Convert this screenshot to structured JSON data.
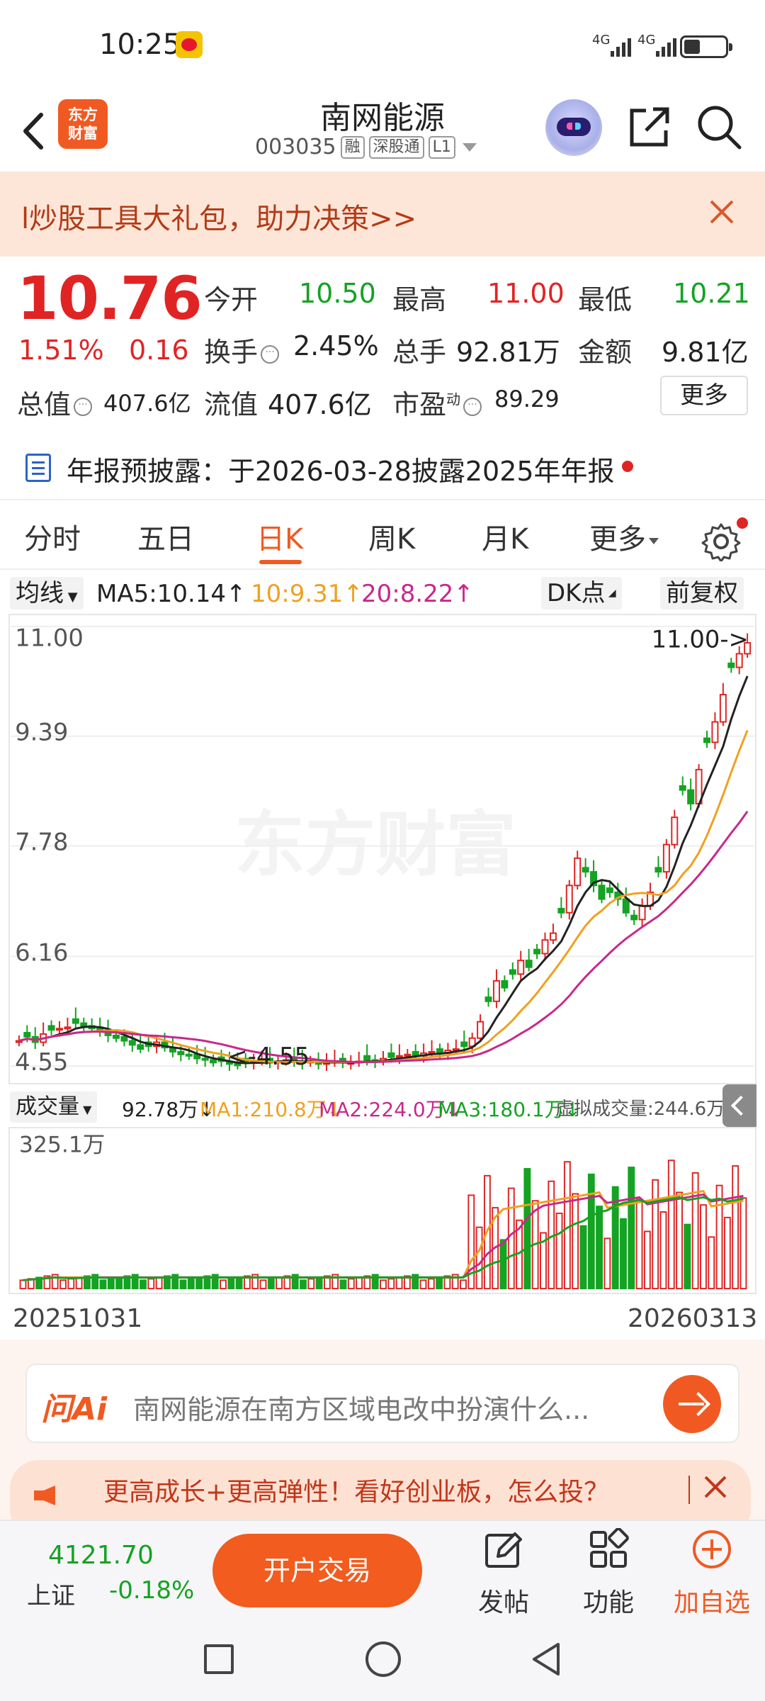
{
  "status_bar": {
    "time": "10:25",
    "signal1": "4G",
    "signal2": "4G",
    "battery_level": 0.3
  },
  "header": {
    "logo_text_line1": "东方",
    "logo_text_line2": "财富",
    "title": "南网能源",
    "code": "003035",
    "tags": [
      "融",
      "深股通",
      "L1"
    ]
  },
  "promo": {
    "text": "l炒股工具大礼包，助力决策>>"
  },
  "quote": {
    "price": "10.76",
    "change_pct": "1.51%",
    "change_amt": "0.16",
    "fields": {
      "open_label": "今开",
      "open_value": "10.50",
      "high_label": "最高",
      "high_value": "11.00",
      "low_label": "最低",
      "low_value": "10.21",
      "turnover_label": "换手",
      "turnover_value": "2.45%",
      "volume_label": "总手",
      "volume_value": "92.81万",
      "amount_label": "金额",
      "amount_value": "9.81亿",
      "mktcap_label": "总值",
      "mktcap_value": "407.6亿",
      "float_label": "流值",
      "float_value": "407.6亿",
      "pe_label": "市盈",
      "pe_superscript": "动",
      "pe_value": "89.29"
    },
    "more_button": "更多"
  },
  "notice": {
    "text": "年报预披露：于2026-03-28披露2025年年报"
  },
  "tabs": {
    "items": [
      "分时",
      "五日",
      "日K",
      "周K",
      "月K",
      "更多"
    ],
    "active": "日K"
  },
  "ma_bar": {
    "selector": "均线",
    "ma5": "MA5:10.14↑",
    "ma10": "10:9.31↑",
    "ma20": "20:8.22↑",
    "dk_button": "DK点",
    "adjust_button": "前复权",
    "colors": {
      "ma5": "#222222",
      "ma10": "#f0a020",
      "ma20": "#c8288c"
    }
  },
  "chart_data": {
    "type": "candlestick",
    "y_ticks": [
      "11.00",
      "9.39",
      "7.78",
      "6.16",
      "4.55"
    ],
    "ylim": [
      4.55,
      11.0
    ],
    "high_marker": "11.00->",
    "low_marker": "<-4.55",
    "watermark": "东方财富",
    "start_date": "20251031",
    "end_date": "20260313",
    "closes": [
      4.92,
      4.98,
      4.9,
      5.02,
      5.08,
      5.1,
      5.12,
      5.18,
      5.14,
      5.1,
      5.06,
      5.0,
      4.96,
      4.92,
      4.86,
      4.8,
      4.84,
      4.9,
      4.82,
      4.76,
      4.72,
      4.7,
      4.66,
      4.64,
      4.6,
      4.62,
      4.58,
      4.56,
      4.6,
      4.62,
      4.64,
      4.6,
      4.62,
      4.64,
      4.62,
      4.6,
      4.62,
      4.58,
      4.6,
      4.62,
      4.6,
      4.6,
      4.62,
      4.64,
      4.62,
      4.66,
      4.68,
      4.7,
      4.72,
      4.7,
      4.74,
      4.76,
      4.74,
      4.78,
      4.8,
      4.84,
      4.96,
      5.2,
      5.5,
      5.8,
      5.7,
      5.9,
      6.1,
      6.0,
      6.2,
      6.4,
      6.5,
      6.8,
      7.2,
      7.6,
      7.4,
      7.2,
      7.0,
      7.1,
      7.0,
      6.8,
      6.7,
      6.9,
      7.1,
      7.4,
      7.8,
      8.2,
      8.6,
      8.4,
      8.9,
      9.3,
      9.6,
      10.0,
      10.4,
      10.6,
      10.76
    ]
  },
  "volume_bar": {
    "selector": "成交量",
    "vol": "92.78万↓",
    "ma1": "MA1:210.8万↓",
    "ma2": "MA2:224.0万↓",
    "ma3": "MA3:180.1万↓",
    "virtual": "虚拟成交量:244.6万",
    "max_label": "325.1万"
  },
  "ai": {
    "logo": "问Ai",
    "placeholder": "南网能源在南方区域电改中扮演什么..."
  },
  "ad": {
    "text": "更高成长+更高弹性！看好创业板，怎么投？"
  },
  "bottom_bar": {
    "index_value": "4121.70",
    "index_name": "上证",
    "index_change": "-0.18%",
    "trade_button": "开户交易",
    "items": [
      {
        "label": "发帖",
        "icon": "edit-icon"
      },
      {
        "label": "功能",
        "icon": "grid-icon"
      },
      {
        "label": "加自选",
        "icon": "plus-circle-icon"
      }
    ]
  }
}
